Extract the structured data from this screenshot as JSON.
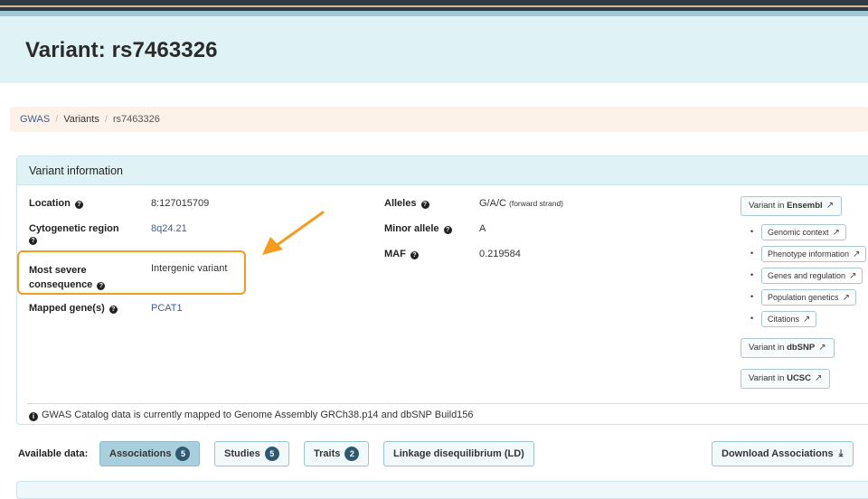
{
  "page_title": "Variant: rs7463326",
  "breadcrumb": {
    "items": [
      "GWAS",
      "Variants"
    ],
    "current": "rs7463326",
    "separator": "/"
  },
  "panel": {
    "title": "Variant information",
    "left_fields": [
      {
        "label": "Location",
        "value": "8:127015709"
      },
      {
        "label": "Cytogenetic region",
        "value": "8q24.21"
      },
      {
        "label_line1": "Most severe",
        "label_line2": "consequence",
        "value": "Intergenic variant"
      },
      {
        "label": "Mapped gene(s)",
        "value": "PCAT1"
      }
    ],
    "mid_fields": [
      {
        "label": "Alleles",
        "value": "G/A/C",
        "value_note": "(forward strand)"
      },
      {
        "label": "Minor allele",
        "value": "A"
      },
      {
        "label": "MAF",
        "value": "0.219584"
      }
    ],
    "ensembl": {
      "prefix": "Variant in ",
      "name": "Ensembl"
    },
    "ensembl_sub": [
      "Genomic context",
      "Phenotype information",
      "Genes and regulation",
      "Population genetics",
      "Citations"
    ],
    "dbsnp": {
      "prefix": "Variant in ",
      "name": "dbSNP"
    },
    "ucsc": {
      "prefix": "Variant in ",
      "name": "UCSC"
    },
    "footnote": "GWAS Catalog data is currently mapped to Genome Assembly GRCh38.p14 and dbSNP Build156"
  },
  "available": {
    "label": "Available data:",
    "tabs": [
      {
        "label": "Associations",
        "count": "5"
      },
      {
        "label": "Studies",
        "count": "5"
      },
      {
        "label": "Traits",
        "count": "2"
      },
      {
        "label": "Linkage disequilibrium (LD)"
      }
    ],
    "download_label": "Download Associations"
  },
  "colors": {
    "accent": "#f39c1f",
    "header_bg": "#dff3f6",
    "link": "#3d5e8c",
    "badge": "#2d5a72"
  },
  "icons": [
    "question-icon",
    "external-link-icon",
    "info-icon",
    "download-icon",
    "annotation-arrow"
  ]
}
